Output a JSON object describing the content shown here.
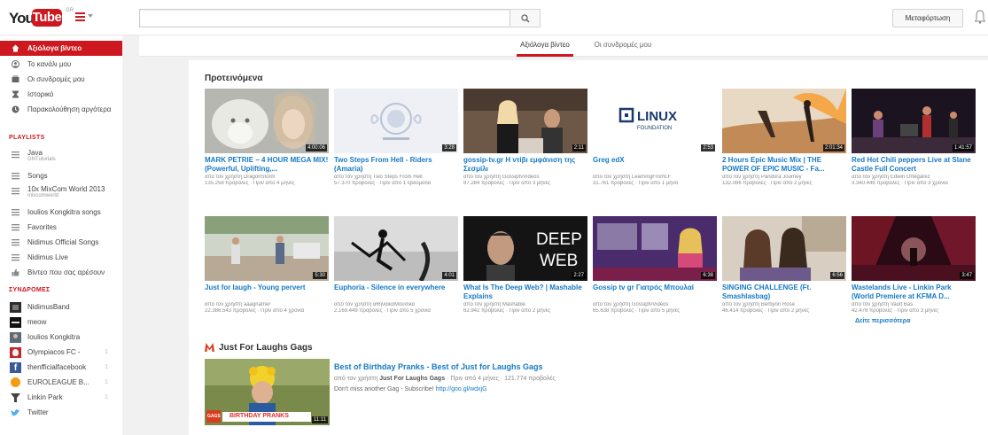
{
  "header": {
    "logo_you": "You",
    "logo_tube": "Tube",
    "logo_region": "GR",
    "search_placeholder": "",
    "upload_label": "Μεταφόρτωση"
  },
  "sidebar": {
    "nav": [
      {
        "label": "Αξιόλογα βίντεο",
        "icon": "home-icon"
      },
      {
        "label": "Το κανάλι μου",
        "icon": "user-icon"
      },
      {
        "label": "Οι συνδρομές μου",
        "icon": "subscriptions-icon"
      },
      {
        "label": "Ιστορικό",
        "icon": "history-icon"
      },
      {
        "label": "Παρακολούθηση αργότερα",
        "icon": "clock-icon"
      }
    ],
    "playlists_heading": "PLAYLISTS",
    "playlists": [
      {
        "label": "Java",
        "sub": "GNTutorials"
      },
      {
        "label": "Songs",
        "sub": ""
      },
      {
        "label": "10x MixCom World 2013",
        "sub": "mixcomworld"
      },
      {
        "label": "Ioulios Kongkitra songs",
        "sub": ""
      },
      {
        "label": "Favorites",
        "sub": ""
      },
      {
        "label": "Nidimus Official Songs",
        "sub": ""
      },
      {
        "label": "Nidimus Live",
        "sub": ""
      },
      {
        "label": "Βίντεο που σας αρέσουν",
        "sub": ""
      }
    ],
    "subs_heading": "ΣΥΝΔΡΟΜΕΣ",
    "subscriptions": [
      {
        "label": "NidimusBand",
        "count": ""
      },
      {
        "label": "meow",
        "count": ""
      },
      {
        "label": "Ioulios Kongkitra",
        "count": ""
      },
      {
        "label": "Olympiacos FC -",
        "count": "1"
      },
      {
        "label": "thenfficialfacebook",
        "count": "1"
      },
      {
        "label": "EUROLEAGUE B...",
        "count": "1"
      },
      {
        "label": "Linkin Park",
        "count": "1"
      },
      {
        "label": "Twitter",
        "count": ""
      }
    ]
  },
  "tabs": [
    {
      "label": "Αξιόλογα βίντεο",
      "active": true
    },
    {
      "label": "Οι συνδρομές μου",
      "active": false
    }
  ],
  "recommended": {
    "title": "Προτεινόμενα",
    "videos": [
      {
        "title": "MARK PETRIE – 4 HOUR MEGA MIX! (Powerful, Uplifting,...",
        "meta1": "από τον χρήστη DragonStorm",
        "meta2": "135.258 προβολές · Πριν από 4 μήνες",
        "duration": "4:00:06",
        "thumb": "wolf"
      },
      {
        "title": "Two Steps From Hell - Riders (Amaria)",
        "meta1": "από τον χρήστη Two Steps From Hell",
        "meta2": "57.370 προβολές · Πριν από 1 εβδομάδα",
        "duration": "3:28",
        "thumb": "emblem"
      },
      {
        "title": "gossip-tv.gr Η ντίβι εμφάνιση της Σεσμίλι",
        "meta1": "από τον χρήστη GossiptvVideos",
        "meta2": "87.284 προβολές · Πριν από 3 μήνες",
        "duration": "2:11",
        "thumb": "studio"
      },
      {
        "title": "Greg edX",
        "meta1": "από τον χρήστη LearningFromLF",
        "meta2": "31.761 προβολές · Πριν από 1 μήνα",
        "duration": "2:53",
        "thumb": "linux"
      },
      {
        "title": "2 Hours Epic Music Mix | THE POWER OF EPIC MUSIC - Fa...",
        "meta1": "από τον χρήστη Pandora Journey",
        "meta2": "132.086 προβολές · Πριν από 2 μήνες",
        "duration": "2:01:34",
        "thumb": "epic"
      },
      {
        "title": "Red Hot Chili peppers Live at Slane Castle Full Concert",
        "meta1": "από τον χρήστη Edwin Ortegarez",
        "meta2": "3.340.446 προβολές · Πριν από 3 χρόνια",
        "duration": "1:41:57",
        "thumb": "concert"
      },
      {
        "title": "Just for laugh - Young pervert",
        "meta1": "από τον χρήστη aaagnamer",
        "meta2": "22.386.543 προβολές · Πριν από 4 χρόνια",
        "duration": "5:30",
        "thumb": "street"
      },
      {
        "title": "Euphoria - Silence in everywhere",
        "meta1": "από τον χρήστη αθηναϊκοΜουσικά",
        "meta2": "2.169.449 προβολές · Πριν από 5 χρόνια",
        "duration": "4:01",
        "thumb": "dance"
      },
      {
        "title": "What Is The Deep Web? | Mashable Explains",
        "meta1": "από τον χρήστη Mashable",
        "meta2": "62.942 προβολές · Πριν από 2 μήνες",
        "duration": "2:27",
        "thumb": "deepweb"
      },
      {
        "title": "Gossip tv gr Γιατρός Μπουλαί",
        "meta1": "από τον χρήστη GossiptvVideos",
        "meta2": "65.638 προβολές · Πριν από 5 μήνες",
        "duration": "6:38",
        "thumb": "tvshow"
      },
      {
        "title": "SINGING CHALLENGE (Ft. Smashlasbag)",
        "meta1": "από τον χρήστη Berbyon Rose",
        "meta2": "46.414 προβολές · Πριν από 2 μήνες",
        "duration": "6:56",
        "thumb": "singing"
      },
      {
        "title": "Wastelands Live - Linkin Park (World Premiere at KFMA D...",
        "meta1": "από τον χρήστη Vault Bas",
        "meta2": "42.476 προβολές · Πριν από 3 μήνες",
        "duration": "3:47",
        "thumb": "stage"
      }
    ],
    "more_label": "Δείτε περισσότερα"
  },
  "channel_shelf": {
    "title": "Just For Laughs Gags",
    "video_title": "Best of Birthday Pranks - Best of Just for Laughs Gags",
    "meta_prefix": "από τον χρήστη",
    "meta_channel": "Just For Laughs Gags",
    "meta_rest": "· Πριν από 4 μήνες · 121.774 προβολές",
    "desc_text": "Don't miss another Gag - Subscribe!",
    "desc_link": "http://goo.gl/wdxjG",
    "duration": "11:11",
    "thumb_banner": "BIRTHDAY PRANKS",
    "thumb_badge": "GAGS"
  },
  "colors": {
    "accent": "#cc181e",
    "link": "#167ac6"
  }
}
